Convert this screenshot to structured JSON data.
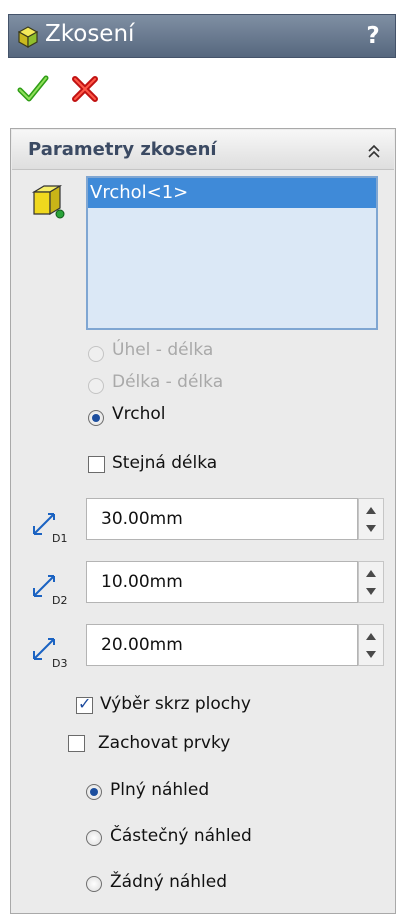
{
  "title_bar": {
    "title": "Zkosení",
    "help_label": "?"
  },
  "actions": {
    "ok": "ok",
    "cancel": "cancel"
  },
  "panel": {
    "title": "Parametry zkosení",
    "selection": {
      "items": [
        "Vrchol<1>"
      ]
    },
    "chamfer_type": {
      "options": [
        {
          "label": "Úhel - délka",
          "enabled": false,
          "selected": false
        },
        {
          "label": "Délka - délka",
          "enabled": false,
          "selected": false
        },
        {
          "label": "Vrchol",
          "enabled": true,
          "selected": true
        }
      ]
    },
    "equal_length": {
      "label": "Stejná délka",
      "checked": false
    },
    "distances": [
      {
        "icon_label": "D1",
        "value": "30.00mm"
      },
      {
        "icon_label": "D2",
        "value": "10.00mm"
      },
      {
        "icon_label": "D3",
        "value": "20.00mm"
      }
    ],
    "select_through_faces": {
      "label": "Výběr skrz plochy",
      "checked": true
    },
    "keep_features": {
      "label": "Zachovat prvky",
      "checked": false
    },
    "preview": {
      "options": [
        {
          "label": "Plný náhled",
          "selected": true
        },
        {
          "label": "Částečný náhled",
          "selected": false
        },
        {
          "label": "Žádný náhled",
          "selected": false
        }
      ]
    }
  },
  "colors": {
    "title_bar": "#5d6e86",
    "panel_bg": "#ebebeb",
    "selection_highlight": "#3f8ad8",
    "header_text": "#3b4a63"
  }
}
